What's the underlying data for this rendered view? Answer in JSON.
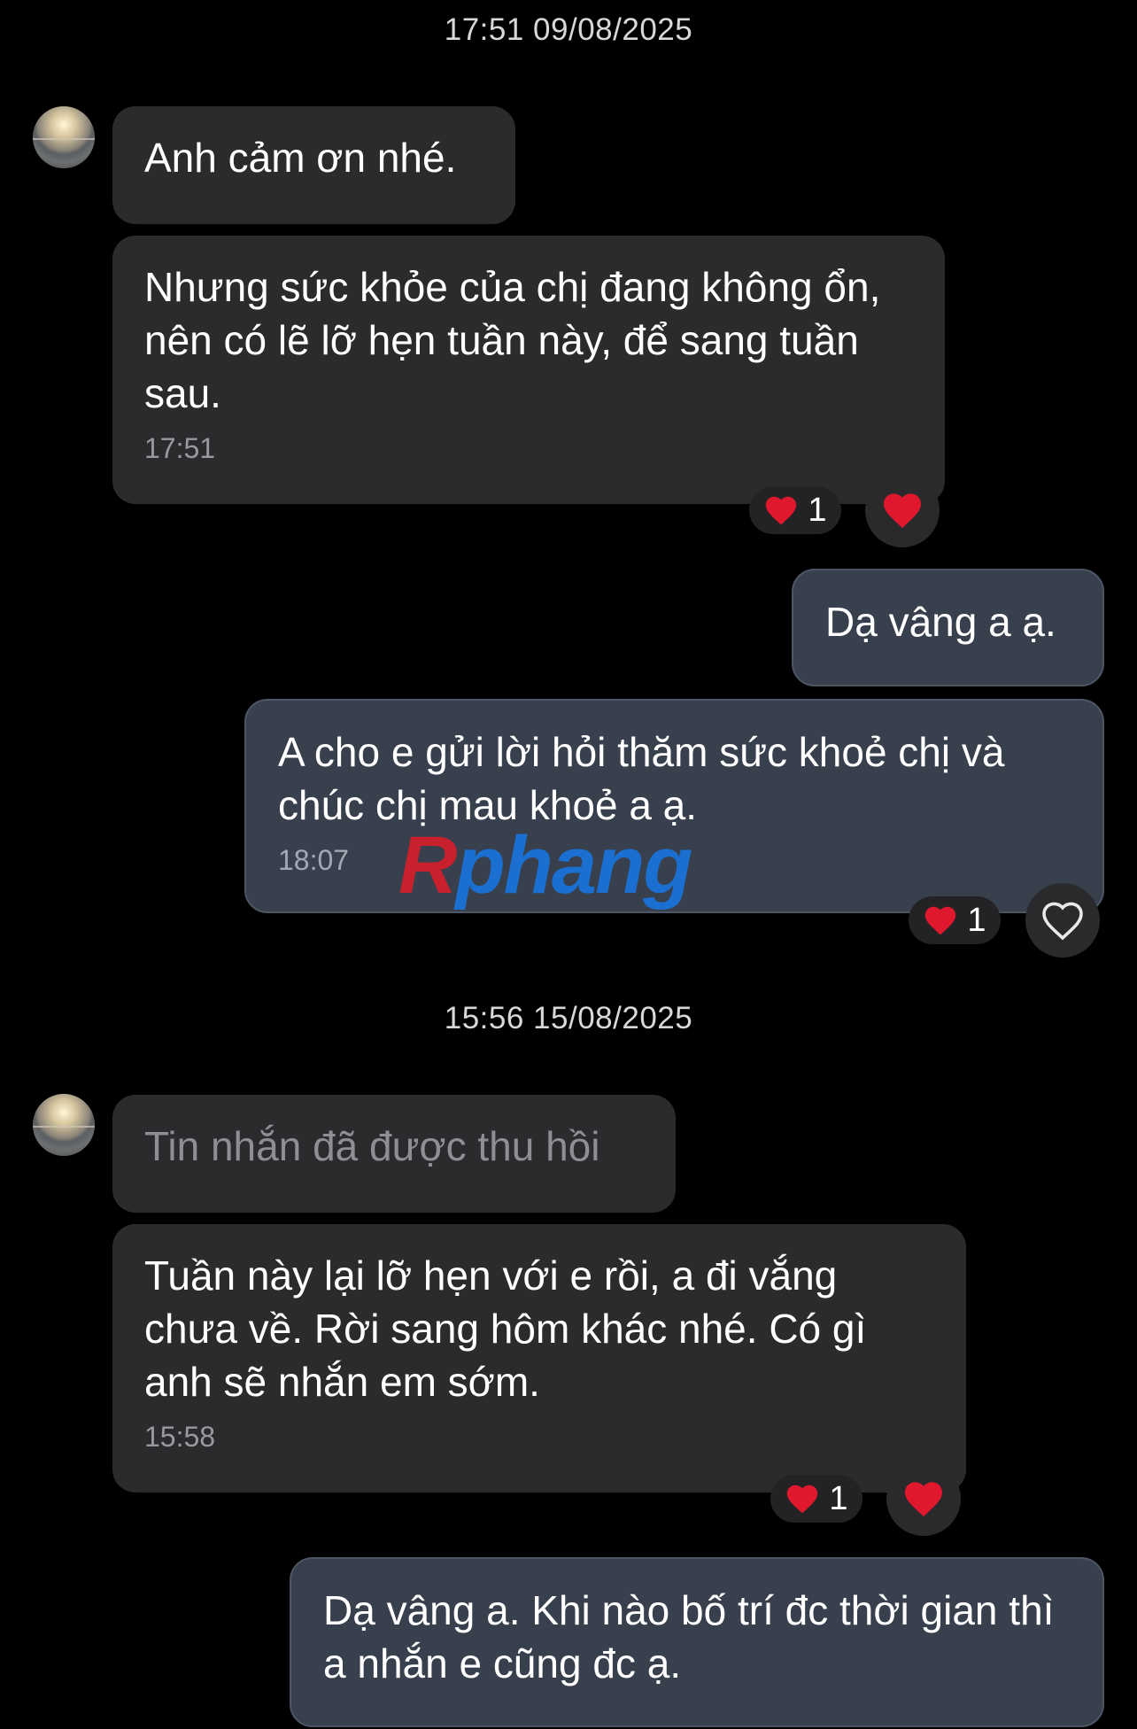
{
  "sections": [
    {
      "timestamp": "17:51 09/08/2025"
    },
    {
      "timestamp": "15:56 15/08/2025"
    }
  ],
  "messages": [
    {
      "text": "Anh cảm ơn nhé."
    },
    {
      "text": "Nhưng sức khỏe của chị đang không ổn, nên có lẽ lỡ hẹn tuần này, để sang tuần sau.",
      "time": "17:51",
      "reaction_count": "1"
    },
    {
      "text": "Dạ vâng a ạ."
    },
    {
      "text": "A cho e gửi lời hỏi thăm sức khoẻ chị và chúc chị mau khoẻ a ạ.",
      "time": "18:07",
      "reaction_count": "1"
    },
    {
      "text": "Tin nhắn đã được thu hồi"
    },
    {
      "text": "Tuần này lại lỡ hẹn với e rồi, a đi vắng chưa về. Rời sang hôm khác nhé. Có gì anh sẽ nhắn em sớm.",
      "time": "15:58",
      "reaction_count": "1"
    },
    {
      "text": "Dạ vâng a. Khi nào bố trí đc thời gian thì a nhắn e cũng đc ạ."
    }
  ],
  "watermark": {
    "first": "R",
    "rest": "phang"
  },
  "icons": {
    "reaction": "heart-icon",
    "react_button": "heart-outline-icon"
  },
  "colors": {
    "incoming_bubble": "#2b2b2d",
    "outgoing_bubble": "#38404d",
    "heart": "#e0182d"
  }
}
